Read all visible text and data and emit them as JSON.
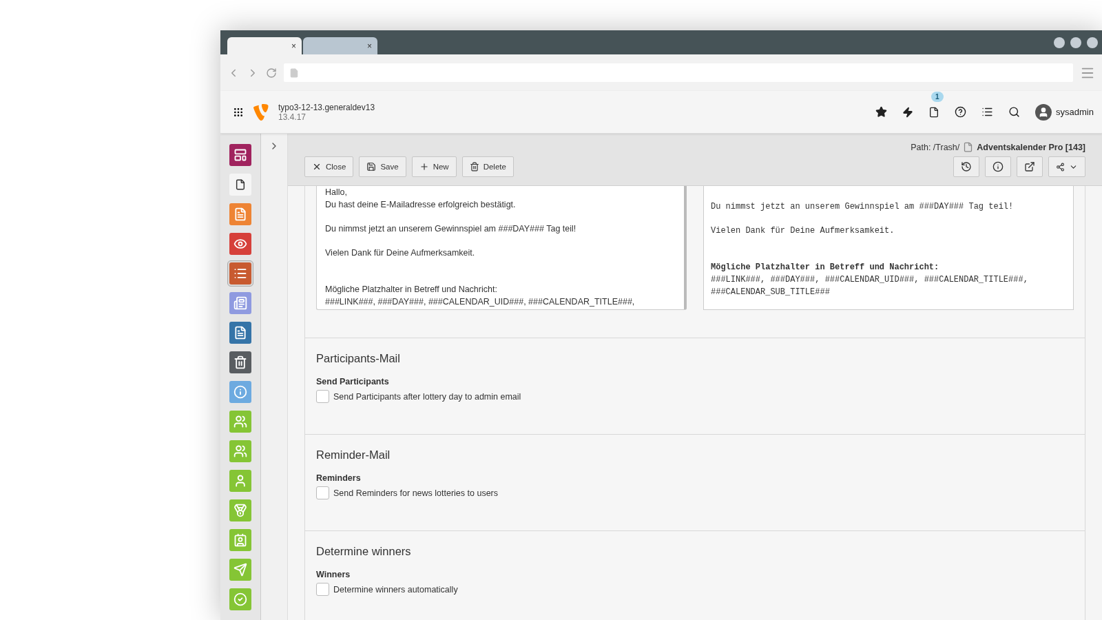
{
  "browser": {
    "tabs": [
      {
        "close": "×",
        "selected": true
      },
      {
        "close": "×",
        "selected": false
      }
    ]
  },
  "topbar": {
    "site_name": "typo3-12-13.generaldev13",
    "version": "13.4.17",
    "badge": "1",
    "user": "sysadmin"
  },
  "modules": [
    {
      "kind": "web",
      "color": "#a0235e",
      "selected": false
    },
    {
      "kind": "page",
      "color": "#f5f5f5",
      "selected": false
    },
    {
      "kind": "doc",
      "color": "#ee8434",
      "selected": false
    },
    {
      "kind": "view",
      "color": "#d6403a",
      "selected": false
    },
    {
      "kind": "list",
      "color": "#c85a30",
      "selected": true
    },
    {
      "kind": "news",
      "color": "#8f9ae0",
      "selected": false
    },
    {
      "kind": "form",
      "color": "#3574a8",
      "selected": false
    },
    {
      "kind": "trash",
      "color": "#595d61",
      "selected": false
    },
    {
      "kind": "info",
      "color": "#6daae0",
      "selected": false
    },
    {
      "kind": "group",
      "color": "#85c535",
      "selected": false
    },
    {
      "kind": "group",
      "color": "#85c535",
      "selected": false
    },
    {
      "kind": "user",
      "color": "#85c535",
      "selected": false
    },
    {
      "kind": "medal",
      "color": "#85c535",
      "selected": false
    },
    {
      "kind": "card",
      "color": "#85c535",
      "selected": false
    },
    {
      "kind": "send",
      "color": "#85c535",
      "selected": false
    },
    {
      "kind": "check",
      "color": "#85c535",
      "selected": false
    }
  ],
  "docheader": {
    "path_label": "Path: /Trash/",
    "record_title": "Adventskalender Pro [143]",
    "buttons": [
      {
        "kind": "close",
        "label": "Close"
      },
      {
        "kind": "save",
        "label": "Save"
      },
      {
        "kind": "new",
        "label": "New"
      },
      {
        "kind": "delete",
        "label": "Delete"
      }
    ]
  },
  "editor": {
    "paragraphs": [
      [
        "Hallo,",
        "Du hast deine E-Mailadresse erfolgreich bestätigt."
      ],
      [
        "Du nimmst jetzt an unserem Gewinnspiel am ###DAY### Tag teil!"
      ],
      [
        "Vielen Dank für Deine Aufmerksamkeit."
      ],
      [
        "Mögliche Platzhalter in Betreff und Nachricht:",
        "###LINK###, ###DAY###, ###CALENDAR_UID###, ###CALENDAR_TITLE###,"
      ]
    ]
  },
  "preview": {
    "paragraphs": [
      [
        "Du nimmst jetzt an unserem Gewinnspiel am ###DAY### Tag teil!"
      ],
      [
        "Vielen Dank für Deine Aufmerksamkeit."
      ],
      [
        "**Mögliche Platzhalter in Betreff und Nachricht:**",
        "###LINK###, ###DAY###, ###CALENDAR_UID###, ###CALENDAR_TITLE###,",
        "###CALENDAR_SUB_TITLE###"
      ]
    ]
  },
  "sections": [
    {
      "title": "Participants-Mail",
      "field_label": "Send Participants",
      "option": "Send Participants after lottery day to admin email",
      "checked": false
    },
    {
      "title": "Reminder-Mail",
      "field_label": "Reminders",
      "option": "Send Reminders for news lotteries to users",
      "checked": false
    },
    {
      "title": "Determine winners",
      "field_label": "Winners",
      "option": "Determine winners automatically",
      "checked": false
    }
  ]
}
